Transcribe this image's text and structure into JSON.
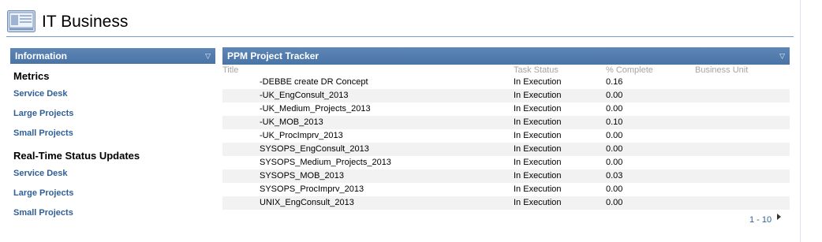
{
  "header": {
    "title": "IT Business",
    "icon": "site-logo-icon"
  },
  "info_panel": {
    "title": "Information",
    "sections": [
      {
        "heading": "Metrics",
        "links": [
          "Service Desk",
          "Large Projects",
          "Small Projects"
        ]
      },
      {
        "heading": "Real-Time Status Updates",
        "links": [
          "Service Desk",
          "Large Projects",
          "Small Projects"
        ]
      }
    ]
  },
  "tracker": {
    "title": "PPM Project Tracker",
    "columns": {
      "title": "Title",
      "status": "Task Status",
      "pct": "% Complete",
      "bu": "Business Unit"
    },
    "rows": [
      {
        "title": "-DEBBE create DR Concept",
        "status": "In Execution",
        "pct": "0.16",
        "bu": ""
      },
      {
        "title": "-UK_EngConsult_2013",
        "status": "In Execution",
        "pct": "0.00",
        "bu": ""
      },
      {
        "title": "-UK_Medium_Projects_2013",
        "status": "In Execution",
        "pct": "0.00",
        "bu": ""
      },
      {
        "title": "-UK_MOB_2013",
        "status": "In Execution",
        "pct": "0.10",
        "bu": ""
      },
      {
        "title": "-UK_ProcImprv_2013",
        "status": "In Execution",
        "pct": "0.00",
        "bu": ""
      },
      {
        "title": "SYSOPS_EngConsult_2013",
        "status": "In Execution",
        "pct": "0.00",
        "bu": ""
      },
      {
        "title": "SYSOPS_Medium_Projects_2013",
        "status": "In Execution",
        "pct": "0.00",
        "bu": ""
      },
      {
        "title": "SYSOPS_MOB_2013",
        "status": "In Execution",
        "pct": "0.03",
        "bu": ""
      },
      {
        "title": "SYSOPS_ProcImprv_2013",
        "status": "In Execution",
        "pct": "0.00",
        "bu": ""
      },
      {
        "title": "UNIX_EngConsult_2013",
        "status": "In Execution",
        "pct": "0.00",
        "bu": ""
      }
    ],
    "pager": "1 - 10"
  },
  "colors": {
    "panel_bar": "#4f79ab",
    "link": "#2f5f97",
    "rule": "#7a9bc8"
  }
}
